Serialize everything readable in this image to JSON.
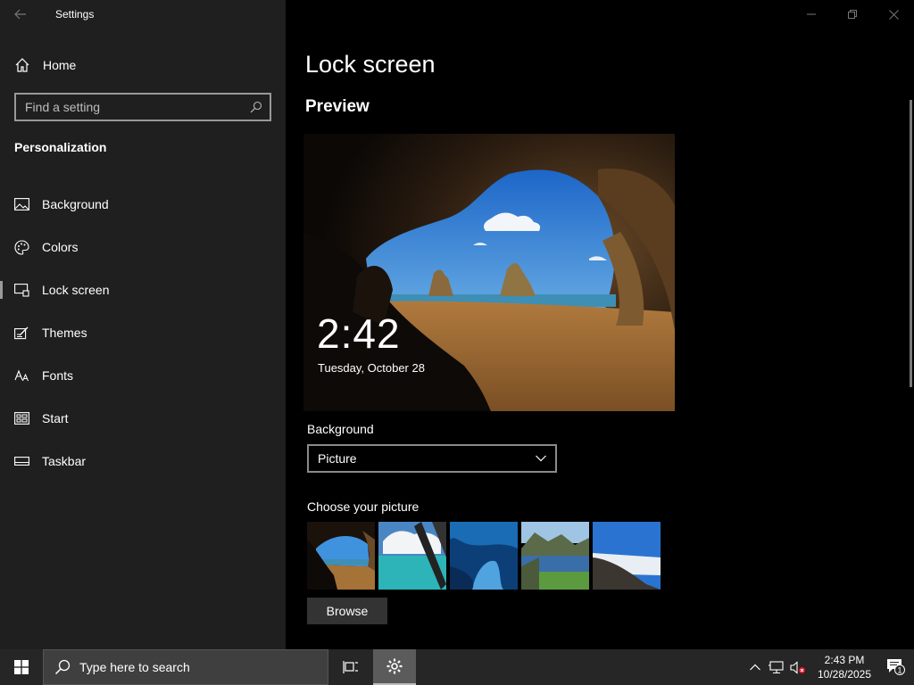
{
  "window": {
    "app_title": "Settings",
    "back_icon": "back-arrow-icon",
    "controls": [
      "minimize-icon",
      "restore-icon",
      "close-icon"
    ]
  },
  "sidebar": {
    "home_label": "Home",
    "search_placeholder": "Find a setting",
    "section_title": "Personalization",
    "items": [
      {
        "label": "Background",
        "icon": "picture-icon",
        "selected": false
      },
      {
        "label": "Colors",
        "icon": "palette-icon",
        "selected": false
      },
      {
        "label": "Lock screen",
        "icon": "lock-screen-icon",
        "selected": true
      },
      {
        "label": "Themes",
        "icon": "themes-icon",
        "selected": false
      },
      {
        "label": "Fonts",
        "icon": "fonts-icon",
        "selected": false
      },
      {
        "label": "Start",
        "icon": "start-icon",
        "selected": false
      },
      {
        "label": "Taskbar",
        "icon": "taskbar-icon",
        "selected": false
      }
    ]
  },
  "main": {
    "title": "Lock screen",
    "preview_title": "Preview",
    "preview_time": "2:42",
    "preview_date": "Tuesday, October 28",
    "background_label": "Background",
    "background_value": "Picture",
    "choose_label": "Choose your picture",
    "browse_label": "Browse"
  },
  "taskbar": {
    "search_placeholder": "Type here to search",
    "time": "2:43 PM",
    "date": "10/28/2025",
    "notification_count": "1"
  },
  "colors": {
    "sidebar_bg": "#1f1f1f",
    "main_bg": "#000000",
    "taskbar_bg": "#262626",
    "button_bg": "#333333"
  }
}
